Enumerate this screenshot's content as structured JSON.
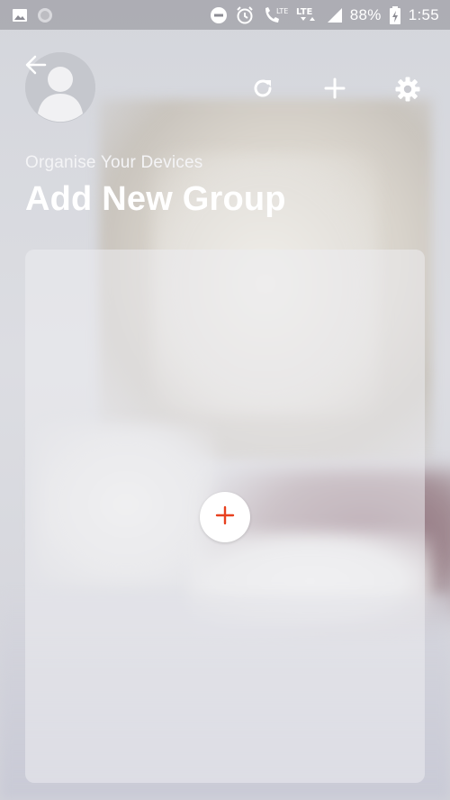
{
  "status_bar": {
    "battery": "88%",
    "time": "1:55",
    "network_label_1": "LTE",
    "network_label_2": "LTE"
  },
  "header": {
    "subtitle": "Organise Your Devices",
    "title": "Add New Group"
  },
  "icons": {
    "back": "arrow-left-icon",
    "avatar": "user-avatar-icon",
    "refresh": "refresh-icon",
    "add": "plus-icon",
    "settings": "gear-icon",
    "add_group": "plus-circle-icon"
  },
  "colors": {
    "accent": "#e8411f",
    "text": "#ffffff"
  }
}
